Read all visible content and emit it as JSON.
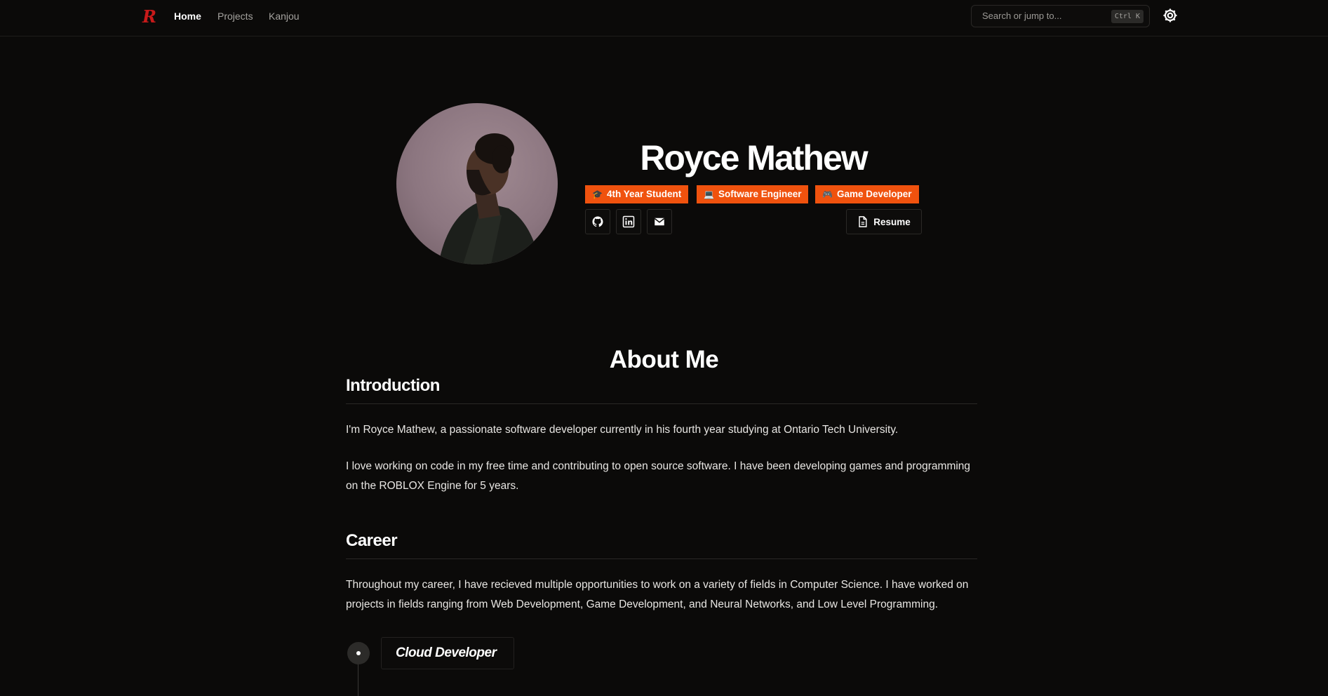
{
  "nav": {
    "logo": "R",
    "links": [
      "Home",
      "Projects",
      "Kanjou"
    ]
  },
  "search": {
    "placeholder": "Search or jump to...",
    "shortcut": "Ctrl K"
  },
  "hero": {
    "name": "Royce Mathew",
    "badges": [
      {
        "icon": "🎓",
        "label": "4th Year Student"
      },
      {
        "icon": "💻",
        "label": "Software Engineer"
      },
      {
        "icon": "🎮",
        "label": "Game Developer"
      }
    ],
    "resume_label": "Resume"
  },
  "about": {
    "title": "About Me",
    "introduction": {
      "heading": "Introduction",
      "p1": "I'm Royce Mathew, a passionate software developer currently in his fourth year studying at Ontario Tech University.",
      "p2": "I love working on code in my free time and contributing to open source software. I have been developing games and programming on the ROBLOX Engine for 5 years."
    },
    "career": {
      "heading": "Career",
      "p1": "Throughout my career, I have recieved multiple opportunities to work on a variety of fields in Computer Science. I have worked on projects in fields ranging from Web Development, Game Development, and Neural Networks, and Low Level Programming."
    },
    "timeline": [
      {
        "title": "Cloud Developer"
      }
    ]
  },
  "colors": {
    "background": "#0b0a09",
    "accent": "#f0520e",
    "logo": "#c81a1a"
  }
}
